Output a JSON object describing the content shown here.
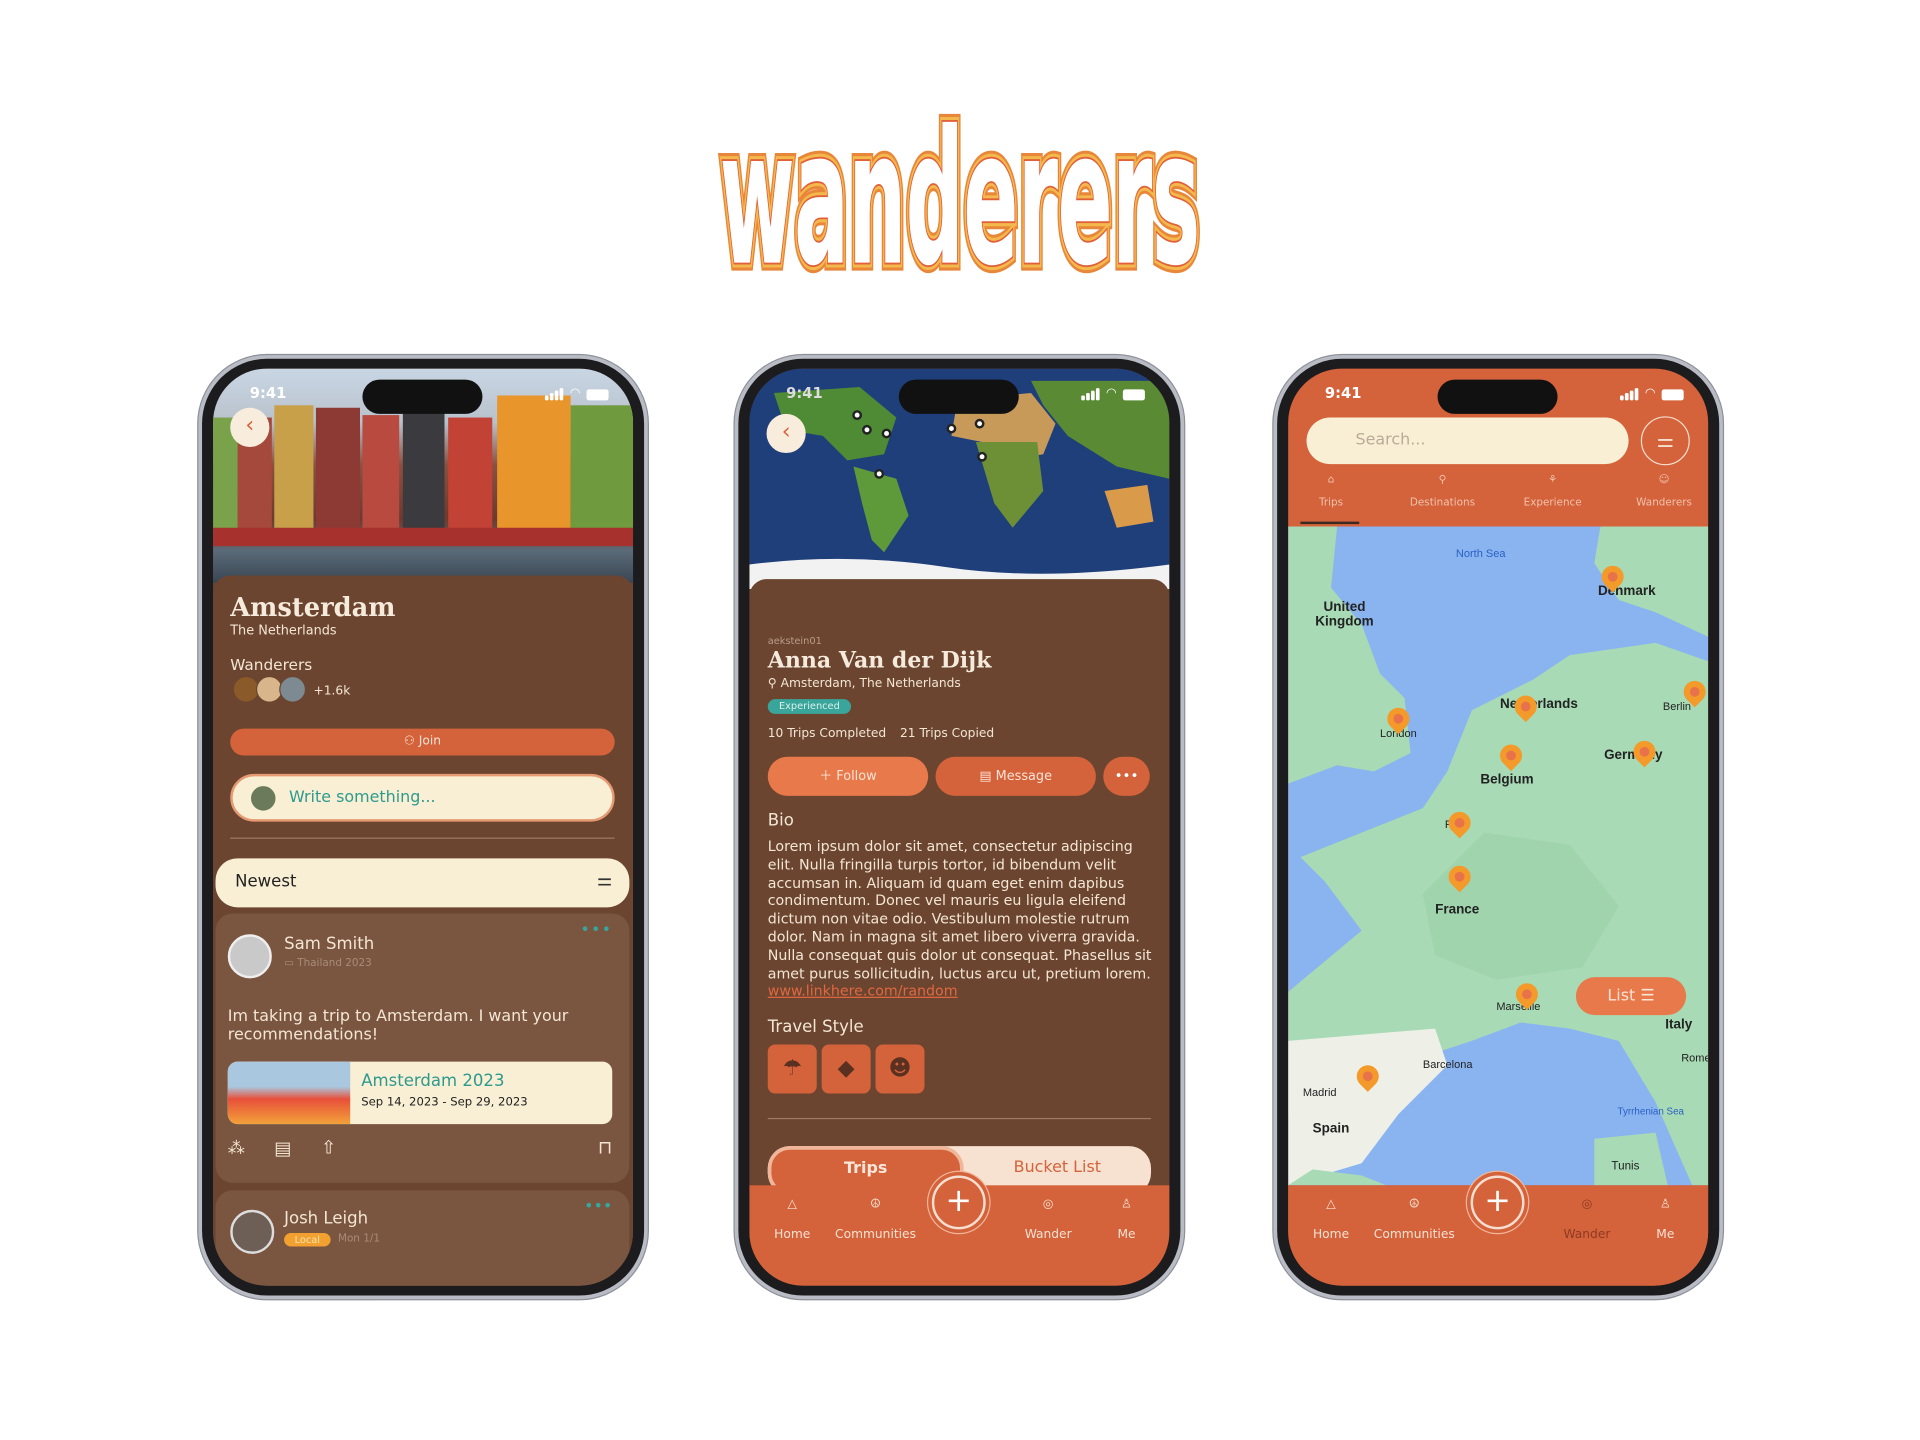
{
  "logo": {
    "text": "wanderers"
  },
  "colors": {
    "brand": "#d4623a",
    "brown": "#6b4530",
    "card": "#7a5540",
    "cream": "#f8efd4",
    "teal": "#3aa59a",
    "pin": "#f39a2b"
  },
  "status": {
    "time": "9:41"
  },
  "community": {
    "title": "Amsterdam",
    "subtitle": "The Netherlands",
    "members_label": "Wanderers",
    "members_count": "+1.6k",
    "join_label": "Join",
    "write_placeholder": "Write something...",
    "sort_label": "Newest",
    "posts": [
      {
        "author": "Sam Smith",
        "meta": "Thailand 2023",
        "text": "Im taking a trip to Amsterdam. I want your recommendations!",
        "trip_title": "Amsterdam 2023",
        "trip_dates": "Sep 14, 2023 - Sep 29, 2023"
      },
      {
        "author": "Josh Leigh",
        "badge": "Local",
        "meta": "Mon 1/1"
      }
    ]
  },
  "profile": {
    "username": "aekstein01",
    "name": "Anna Van der Dijk",
    "location": "Amsterdam, The Netherlands",
    "badge": "Experienced",
    "trips_completed": "10 Trips Completed",
    "trips_copied": "21 Trips Copied",
    "follow_label": "Follow",
    "message_label": "Message",
    "more_label": "•••",
    "bio_heading": "Bio",
    "bio": "Lorem ipsum dolor sit amet, consectetur adipiscing elit. Nulla fringilla turpis tortor, id bibendum velit accumsan in. Aliquam id quam eget enim dapibus condimentum. Donec vel mauris eu ligula eleifend dictum non vitae odio. Vestibulum molestie rutrum dolor. Nam in magna sit amet libero viverra gravida. Nulla consequat quis dolor ut consequat. Phasellus sit amet purus sollicitudin, luctus arcu ut, pretium lorem.",
    "link": "www.linkhere.com/random",
    "travel_style_heading": "Travel Style",
    "travel_styles": [
      "parachute-icon",
      "diamond-icon",
      "theater-masks-icon"
    ],
    "tabs": [
      {
        "label": "Trips",
        "active": true
      },
      {
        "label": "Bucket List",
        "active": false
      }
    ]
  },
  "explore": {
    "search_placeholder": "Search...",
    "tabs": [
      {
        "label": "Trips",
        "icon": "backpack-icon",
        "active": true
      },
      {
        "label": "Destinations",
        "icon": "location-pin-icon"
      },
      {
        "label": "Experience",
        "icon": "runner-icon"
      },
      {
        "label": "Wanderers",
        "icon": "user-circle-icon"
      }
    ],
    "map_labels": [
      "North Sea",
      "Denmark",
      "United Kingdom",
      "London",
      "Netherlands",
      "Berlin",
      "Germany",
      "Belgium",
      "Paris",
      "France",
      "Marseille",
      "Italy",
      "Rome",
      "Barcelona",
      "Madrid",
      "Spain",
      "Tyrrhenian Sea",
      "Tunis"
    ],
    "list_label": "List"
  },
  "nav": {
    "home": "Home",
    "communities": "Communities",
    "wander": "Wander",
    "me": "Me"
  }
}
